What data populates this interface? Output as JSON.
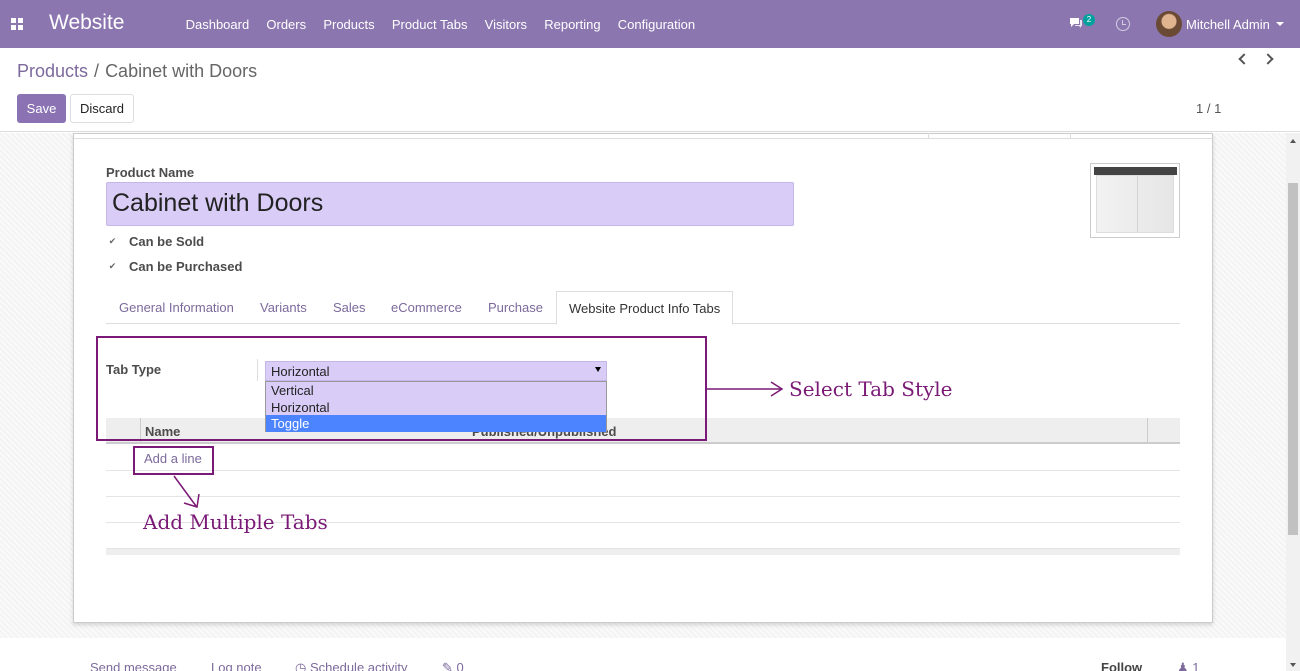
{
  "topbar": {
    "brand": "Website",
    "menu": [
      "Dashboard",
      "Orders",
      "Products",
      "Product Tabs",
      "Visitors",
      "Reporting",
      "Configuration"
    ],
    "message_count": "2",
    "user_name": "Mitchell Admin"
  },
  "breadcrumb": {
    "parent": "Products",
    "separator": "/",
    "current": "Cabinet with Doors"
  },
  "buttons": {
    "save": "Save",
    "discard": "Discard"
  },
  "pager": {
    "value": "1 / 1"
  },
  "form": {
    "product_name_label": "Product Name",
    "product_name": "Cabinet with Doors",
    "can_be_sold_label": "Can be Sold",
    "can_be_sold": true,
    "can_be_purchased_label": "Can be Purchased",
    "can_be_purchased": true,
    "checkmark": "✔"
  },
  "tabs": [
    {
      "label": "General Information",
      "active": false
    },
    {
      "label": "Variants",
      "active": false
    },
    {
      "label": "Sales",
      "active": false
    },
    {
      "label": "eCommerce",
      "active": false
    },
    {
      "label": "Purchase",
      "active": false
    },
    {
      "label": "Website Product Info Tabs",
      "active": true
    }
  ],
  "tab_type": {
    "label": "Tab Type",
    "value": "Horizontal",
    "options": [
      "Vertical",
      "Horizontal",
      "Toggle"
    ],
    "highlighted": "Toggle"
  },
  "table": {
    "columns": [
      "Name",
      "Published/Unpublished"
    ],
    "add_line": "Add a line"
  },
  "annotations": {
    "select_tab_style": "Select Tab Style",
    "add_multiple_tabs": "Add Multiple Tabs",
    "color": "#7a1a76"
  },
  "chatter": {
    "send_message": "Send message",
    "log_note": "Log note",
    "schedule_activity": "Schedule activity",
    "attachments": "0",
    "follow": "Follow",
    "followers": "1"
  },
  "colors": {
    "topbar": "#8b76b0",
    "primary": "#8a72b3",
    "field_bg": "#d9ccf7",
    "option_highlight": "#4c83ff"
  }
}
